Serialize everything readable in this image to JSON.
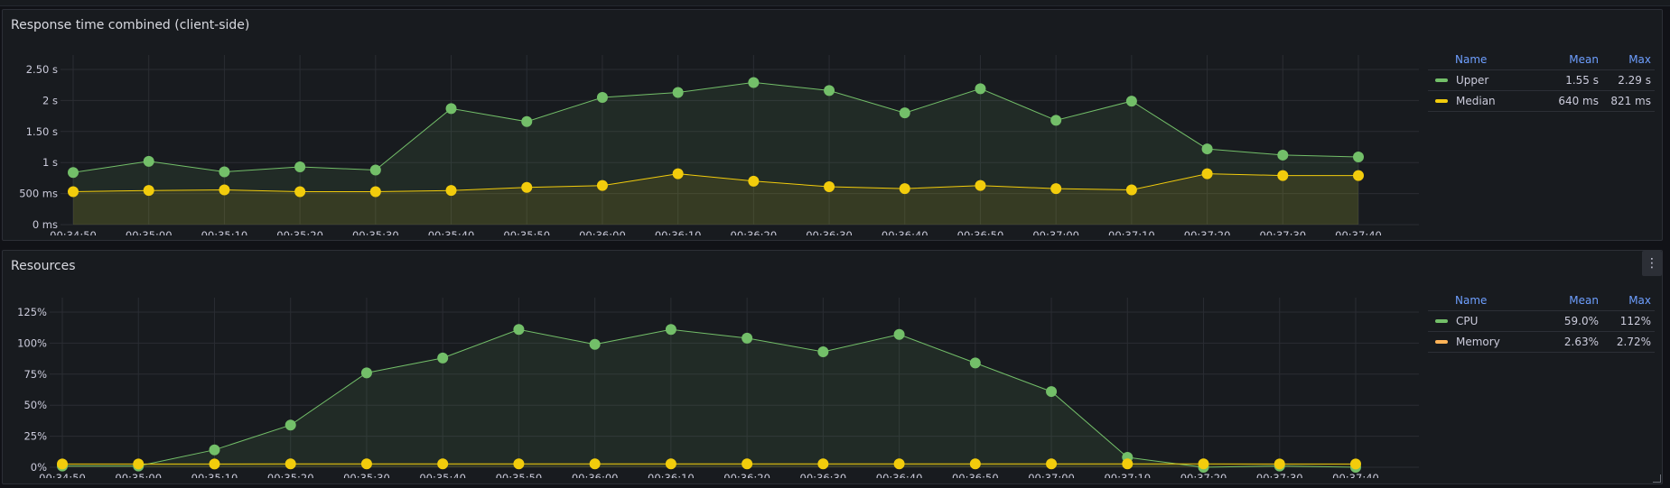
{
  "panels": [
    {
      "title": "Response time combined (client-side)",
      "legend": {
        "headers": {
          "name": "Name",
          "mean": "Mean",
          "max": "Max"
        },
        "rows": [
          {
            "name": "Upper",
            "mean": "1.55 s",
            "max": "2.29 s",
            "color": "#73bf69"
          },
          {
            "name": "Median",
            "mean": "640 ms",
            "max": "821 ms",
            "color": "#f2cc0c"
          }
        ]
      }
    },
    {
      "title": "Resources",
      "menu_icon": "kebab-menu-icon",
      "legend": {
        "headers": {
          "name": "Name",
          "mean": "Mean",
          "max": "Max"
        },
        "rows": [
          {
            "name": "CPU",
            "mean": "59.0%",
            "max": "112%",
            "color": "#73bf69"
          },
          {
            "name": "Memory",
            "mean": "2.63%",
            "max": "2.72%",
            "color": "#ffb357"
          }
        ]
      }
    }
  ],
  "chart_data": [
    {
      "type": "line",
      "title": "Response time combined (client-side)",
      "x": [
        "00:34:50",
        "00:35:00",
        "00:35:10",
        "00:35:20",
        "00:35:30",
        "00:35:40",
        "00:35:50",
        "00:36:00",
        "00:36:10",
        "00:36:20",
        "00:36:30",
        "00:36:40",
        "00:36:50",
        "00:37:00",
        "00:37:10",
        "00:37:20",
        "00:37:30",
        "00:37:40"
      ],
      "ylim": [
        0,
        2.5
      ],
      "yticks": [
        0,
        0.5,
        1,
        1.5,
        2,
        2.5
      ],
      "ytick_labels": [
        "0 ms",
        "500 ms",
        "1 s",
        "1.50 s",
        "2 s",
        "2.50 s"
      ],
      "grid": true,
      "legend_position": "right",
      "series": [
        {
          "name": "Upper",
          "color": "#73bf69",
          "values": [
            0.84,
            1.02,
            0.85,
            0.93,
            0.88,
            1.87,
            1.66,
            2.05,
            2.13,
            2.29,
            2.16,
            1.8,
            2.19,
            1.68,
            1.99,
            1.22,
            1.12,
            1.09
          ]
        },
        {
          "name": "Median",
          "color": "#f2cc0c",
          "values": [
            0.53,
            0.55,
            0.56,
            0.53,
            0.53,
            0.55,
            0.6,
            0.63,
            0.82,
            0.7,
            0.61,
            0.58,
            0.63,
            0.58,
            0.56,
            0.82,
            0.79,
            0.79
          ]
        }
      ]
    },
    {
      "type": "line",
      "title": "Resources",
      "x": [
        "00:34:50",
        "00:35:00",
        "00:35:10",
        "00:35:20",
        "00:35:30",
        "00:35:40",
        "00:35:50",
        "00:36:00",
        "00:36:10",
        "00:36:20",
        "00:36:30",
        "00:36:40",
        "00:36:50",
        "00:37:00",
        "00:37:10",
        "00:37:20",
        "00:37:30",
        "00:37:40"
      ],
      "ylim": [
        0,
        125
      ],
      "yticks": [
        0,
        25,
        50,
        75,
        100,
        125
      ],
      "ytick_labels": [
        "0%",
        "25%",
        "50%",
        "75%",
        "100%",
        "125%"
      ],
      "grid": true,
      "legend_position": "right",
      "series": [
        {
          "name": "CPU",
          "color": "#73bf69",
          "values": [
            1,
            1,
            14,
            34,
            76,
            88,
            111,
            99,
            111,
            104,
            93,
            107,
            84,
            61,
            8,
            0,
            1,
            0
          ]
        },
        {
          "name": "Memory",
          "color": "#f2cc0c",
          "values": [
            2.6,
            2.6,
            2.6,
            2.7,
            2.7,
            2.7,
            2.7,
            2.7,
            2.7,
            2.7,
            2.7,
            2.7,
            2.7,
            2.7,
            2.7,
            2.7,
            2.6,
            2.6
          ]
        }
      ]
    }
  ]
}
